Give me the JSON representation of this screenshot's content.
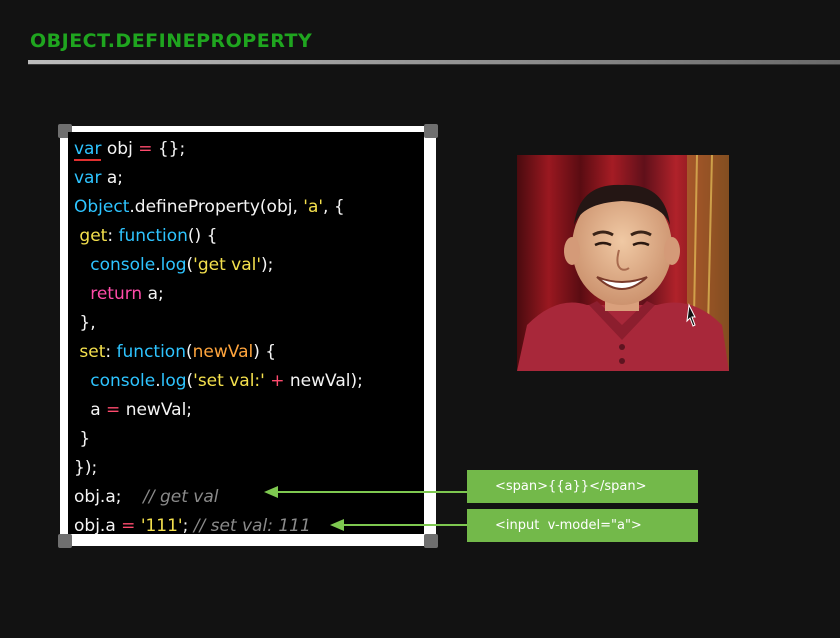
{
  "slide": {
    "title": "OBJECT.DEFINEPROPERTY"
  },
  "code": {
    "lines": [
      [
        {
          "t": "var",
          "c": "kw ul"
        },
        {
          "t": " obj ",
          "c": ""
        },
        {
          "t": "=",
          "c": "op"
        },
        {
          "t": " {};",
          "c": ""
        }
      ],
      [
        {
          "t": "var",
          "c": "kw"
        },
        {
          "t": " a;",
          "c": ""
        }
      ],
      [
        {
          "t": "Object",
          "c": "kw"
        },
        {
          "t": ".",
          "c": ""
        },
        {
          "t": "defineProperty",
          "c": ""
        },
        {
          "t": "(obj, ",
          "c": ""
        },
        {
          "t": "'a'",
          "c": "str"
        },
        {
          "t": ", {",
          "c": ""
        }
      ],
      [
        {
          "t": " ",
          "c": ""
        },
        {
          "t": "get",
          "c": "prop"
        },
        {
          "t": ": ",
          "c": ""
        },
        {
          "t": "function",
          "c": "fn"
        },
        {
          "t": "() {",
          "c": ""
        }
      ],
      [
        {
          "t": "   ",
          "c": ""
        },
        {
          "t": "console",
          "c": "kw"
        },
        {
          "t": ".",
          "c": ""
        },
        {
          "t": "log",
          "c": "kw"
        },
        {
          "t": "(",
          "c": ""
        },
        {
          "t": "'get val'",
          "c": "str"
        },
        {
          "t": ");",
          "c": ""
        }
      ],
      [
        {
          "t": "   ",
          "c": ""
        },
        {
          "t": "return",
          "c": "ret"
        },
        {
          "t": " a;",
          "c": ""
        }
      ],
      [
        {
          "t": " },",
          "c": ""
        }
      ],
      [
        {
          "t": " ",
          "c": ""
        },
        {
          "t": "set",
          "c": "prop"
        },
        {
          "t": ": ",
          "c": ""
        },
        {
          "t": "function",
          "c": "fn"
        },
        {
          "t": "(",
          "c": ""
        },
        {
          "t": "newVal",
          "c": "param"
        },
        {
          "t": ") {",
          "c": ""
        }
      ],
      [
        {
          "t": "   ",
          "c": ""
        },
        {
          "t": "console",
          "c": "kw"
        },
        {
          "t": ".",
          "c": ""
        },
        {
          "t": "log",
          "c": "kw"
        },
        {
          "t": "(",
          "c": ""
        },
        {
          "t": "'set val:'",
          "c": "str"
        },
        {
          "t": " ",
          "c": ""
        },
        {
          "t": "+",
          "c": "op"
        },
        {
          "t": " newVal);",
          "c": ""
        }
      ],
      [
        {
          "t": "   a ",
          "c": ""
        },
        {
          "t": "=",
          "c": "op"
        },
        {
          "t": " newVal;",
          "c": ""
        }
      ],
      [
        {
          "t": " }",
          "c": ""
        }
      ],
      [
        {
          "t": "});",
          "c": ""
        }
      ],
      [
        {
          "t": "obj",
          "c": ""
        },
        {
          "t": ".",
          "c": ""
        },
        {
          "t": "a;",
          "c": ""
        },
        {
          "t": "    // get val",
          "c": "cmt"
        }
      ],
      [
        {
          "t": "obj",
          "c": ""
        },
        {
          "t": ".",
          "c": ""
        },
        {
          "t": "a ",
          "c": ""
        },
        {
          "t": "=",
          "c": "op"
        },
        {
          "t": " ",
          "c": ""
        },
        {
          "t": "'111'",
          "c": "str"
        },
        {
          "t": "; ",
          "c": ""
        },
        {
          "t": "// set val: 111",
          "c": "cmt"
        }
      ]
    ]
  },
  "annotations": {
    "box1_label": "<span>{{a}}</span>",
    "box2_label": "<input  v-model=\"a\">"
  },
  "colors": {
    "title": "#1fa51f",
    "keyword": "#2ec4ff",
    "string": "#f4e04d",
    "return": "#ff4ba8",
    "operator": "#ff4b6e",
    "param": "#ffa53d",
    "comment": "#8a8a8a",
    "annotation_box": "#73b94a",
    "arrow": "#7ec850"
  },
  "photo": {
    "subject": "smiling man in red traditional jacket on stage"
  }
}
